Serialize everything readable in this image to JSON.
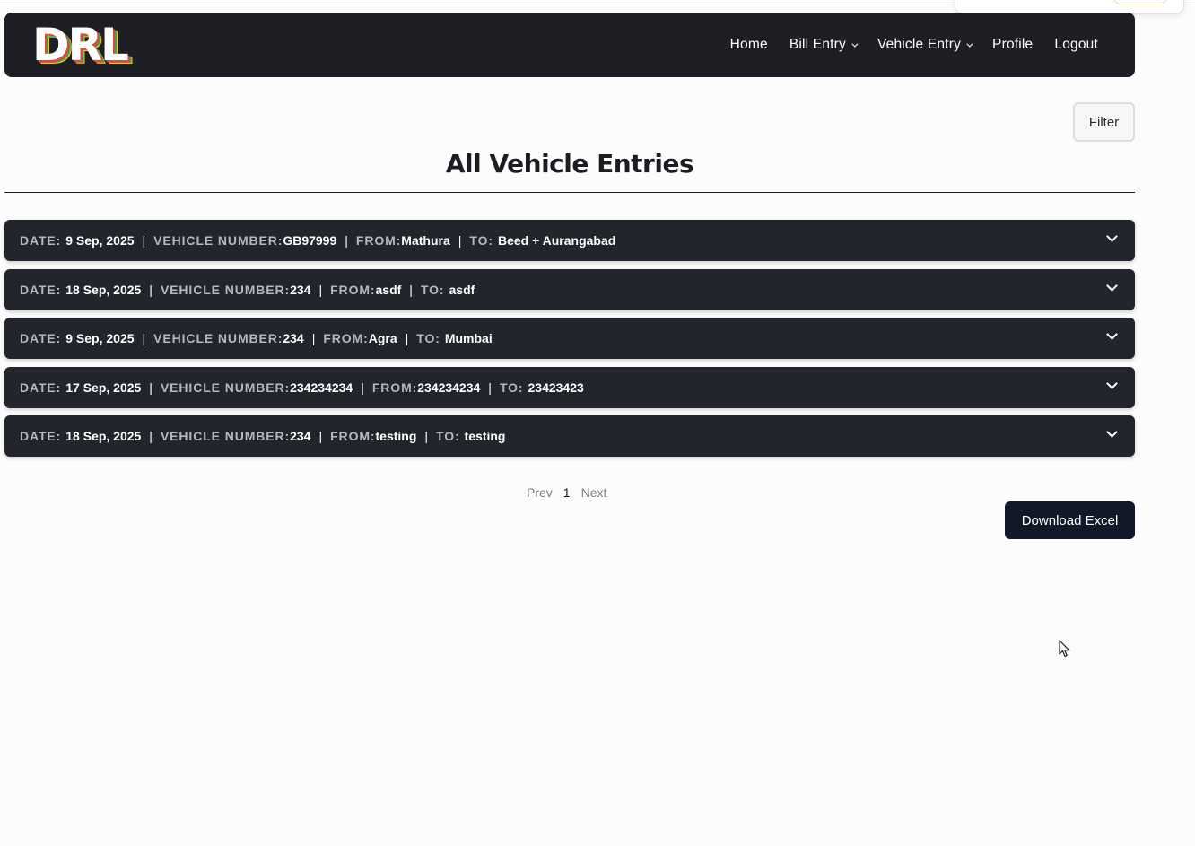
{
  "brand": {
    "logo_text": "DRL"
  },
  "nav": {
    "items": [
      {
        "label": "Home",
        "has_dropdown": false
      },
      {
        "label": "Bill Entry",
        "has_dropdown": true
      },
      {
        "label": "Vehicle Entry",
        "has_dropdown": true
      },
      {
        "label": "Profile",
        "has_dropdown": false
      },
      {
        "label": "Logout",
        "has_dropdown": false
      }
    ]
  },
  "filter": {
    "label": "Filter"
  },
  "page": {
    "title": "All Vehicle Entries"
  },
  "field_labels": {
    "date": "DATE:",
    "vehicle_number": "VEHICLE NUMBER:",
    "from": "FROM:",
    "to": "TO:",
    "separator": "|"
  },
  "entries": [
    {
      "date": "9 Sep, 2025",
      "vehicle_number": "GB97999",
      "from": "Mathura",
      "to": "Beed + Aurangabad"
    },
    {
      "date": "18 Sep, 2025",
      "vehicle_number": "234",
      "from": "asdf",
      "to": "asdf"
    },
    {
      "date": "9 Sep, 2025",
      "vehicle_number": "234",
      "from": "Agra",
      "to": "Mumbai"
    },
    {
      "date": "17 Sep, 2025",
      "vehicle_number": "234234234",
      "from": "234234234",
      "to": "23423423"
    },
    {
      "date": "18 Sep, 2025",
      "vehicle_number": "234",
      "from": "testing",
      "to": "testing"
    }
  ],
  "pagination": {
    "prev_label": "Prev",
    "current_page": "1",
    "next_label": "Next"
  },
  "actions": {
    "download_label": "Download Excel"
  },
  "colors": {
    "navbar_bg": "#1d1f24",
    "row_bg": "#22252b",
    "download_bg": "#111827",
    "page_bg": "#fcfcfc"
  }
}
